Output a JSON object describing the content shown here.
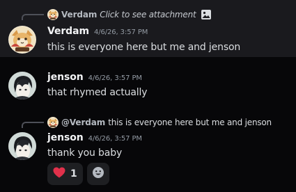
{
  "messages": [
    {
      "author": "Verdam",
      "timestamp": "4/6/26, 3:57 PM",
      "content": "this is everyone here but me and jenson",
      "avatar_icon": "cat-avatar-icon",
      "reply": {
        "author": "Verdam",
        "text": "Click to see attachment",
        "icon": "image-icon"
      }
    },
    {
      "author": "jenson",
      "timestamp": "4/6/26, 3:57 PM",
      "content": "that rhymed actually",
      "avatar_icon": "anime-avatar-icon"
    },
    {
      "author": "jenson",
      "timestamp": "4/6/26, 3:57 PM",
      "content": "thank you baby",
      "avatar_icon": "anime-avatar-icon",
      "reply": {
        "author": "@Verdam",
        "text": "this is everyone here but me and jenson"
      },
      "reactions": [
        {
          "emoji": "heart-icon",
          "count": "1"
        }
      ],
      "add_reaction_icon": "add-reaction-icon"
    }
  ],
  "colors": {
    "background": "#070709",
    "highlight": "#1a1a1e",
    "reaction_bg": "#1e1f22",
    "heart": "#e1314b"
  }
}
